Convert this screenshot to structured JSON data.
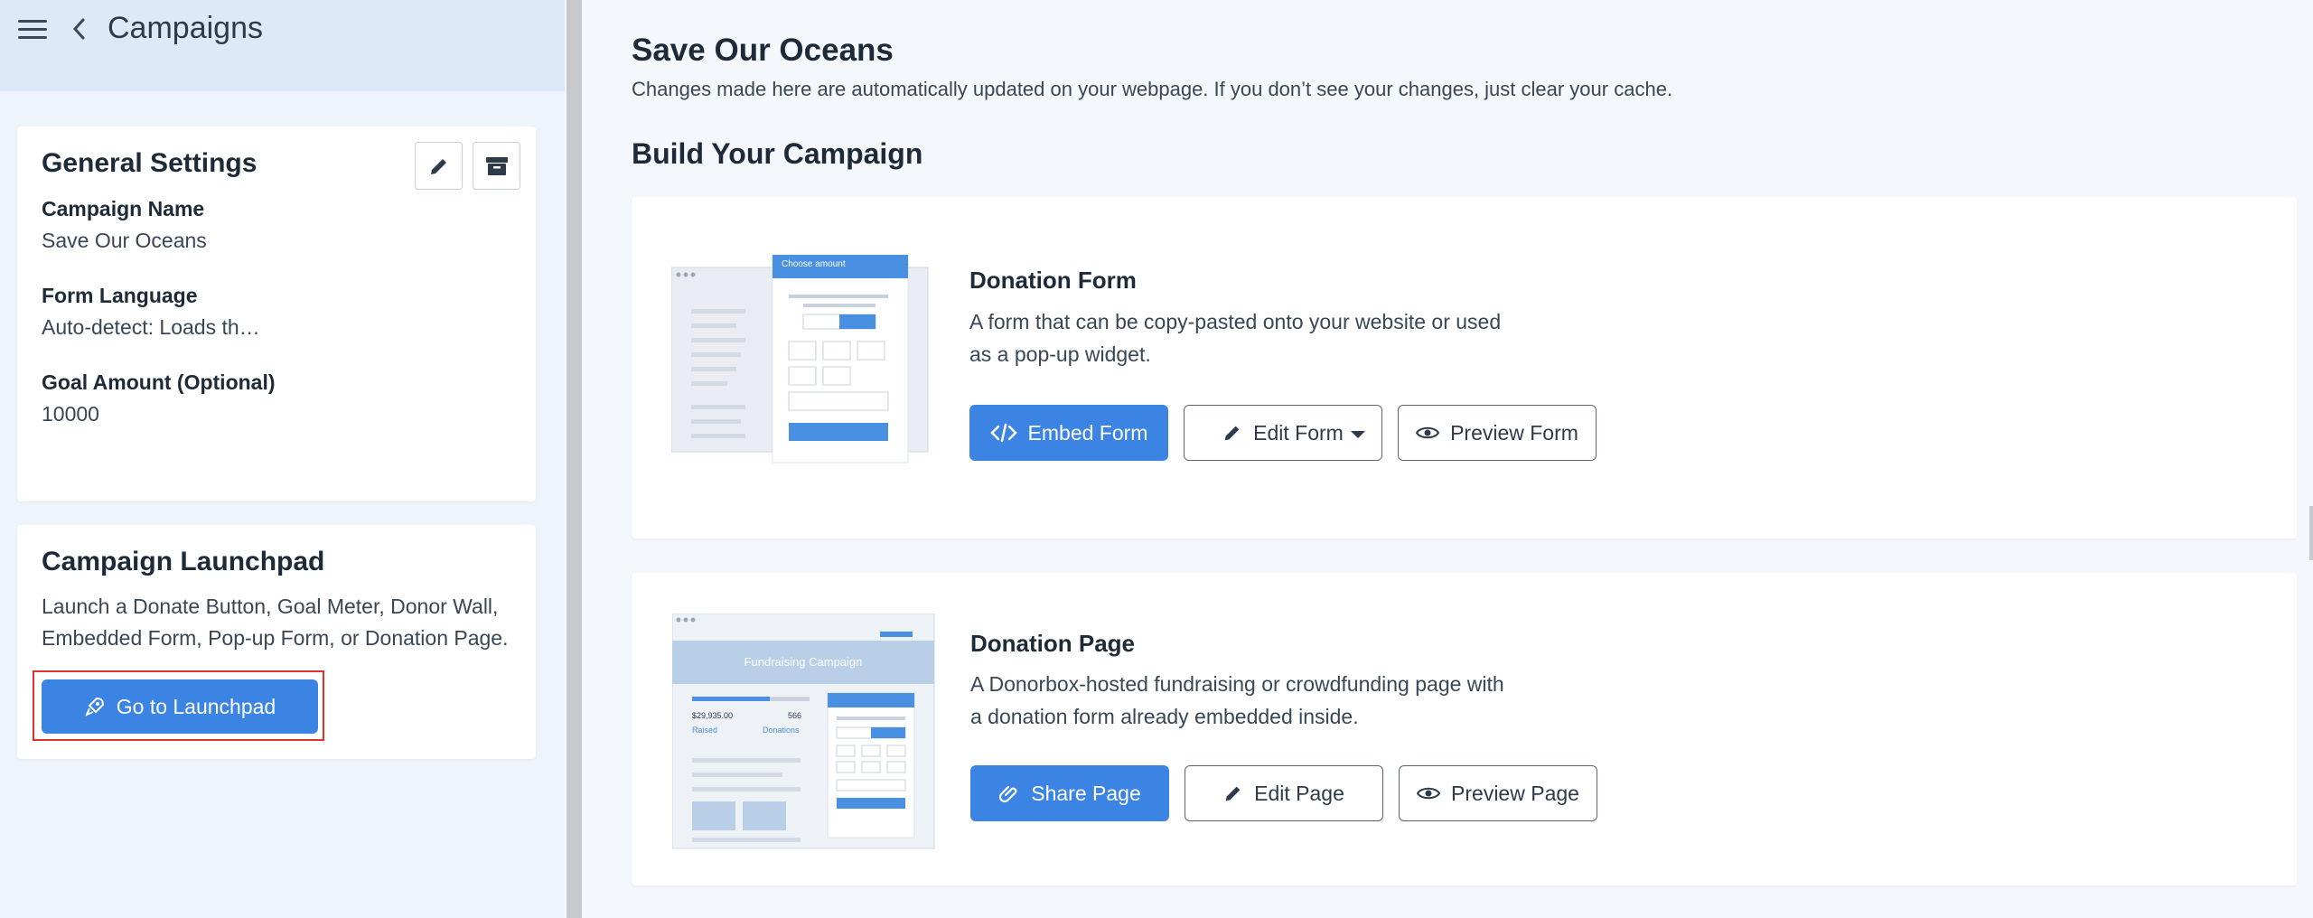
{
  "sidebar": {
    "title": "Campaigns",
    "settings": {
      "title": "General Settings",
      "fields": [
        {
          "label": "Campaign Name",
          "value": "Save Our Oceans"
        },
        {
          "label": "Form Language",
          "value": "Auto-detect: Loads th…"
        },
        {
          "label": "Goal Amount (Optional)",
          "value": "10000"
        }
      ]
    },
    "launchpad": {
      "title": "Campaign Launchpad",
      "description": "Launch a Donate Button, Goal Meter, Donor Wall, Embedded Form, Pop-up Form, or Donation Page.",
      "button_label": "Go to Launchpad"
    }
  },
  "main": {
    "title": "Save Our Oceans",
    "subtitle": "Changes made here are automatically updated on your webpage. If you don’t see your changes, just clear your cache.",
    "section_title": "Build Your Campaign",
    "form": {
      "title": "Donation Form",
      "description": "A form that can be copy-pasted onto your website or used as a pop-up widget.",
      "embed_label": "Embed Form",
      "edit_label": "Edit Form",
      "preview_label": "Preview Form",
      "thumb_header": "Choose amount"
    },
    "page": {
      "title": "Donation Page",
      "description": "A Donorbox-hosted fundraising or crowdfunding page with a donation form already embedded inside.",
      "share_label": "Share Page",
      "edit_label": "Edit Page",
      "preview_label": "Preview Page",
      "thumb_banner": "Fundraising Campaign",
      "thumb_raised_amount": "$29,935.00",
      "thumb_raised_label": "Raised",
      "thumb_donations_count": "566",
      "thumb_donations_label": "Donations"
    }
  },
  "colors": {
    "accent": "#3b84e3",
    "highlight": "#e0322b",
    "sidebar_header": "#dce9f9"
  }
}
